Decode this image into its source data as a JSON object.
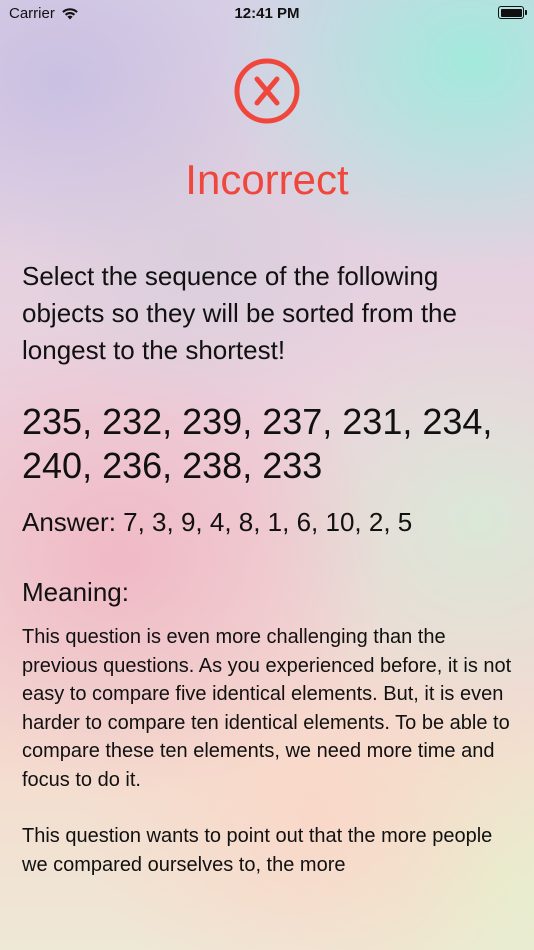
{
  "status_bar": {
    "carrier": "Carrier",
    "time": "12:41 PM",
    "battery_level": 1.0
  },
  "result": {
    "icon": "x-circle-icon",
    "title": "Incorrect",
    "color": "#f0473d"
  },
  "question": {
    "text": "Select the sequence of the following objects so they will be sorted from the longest to the shortest!",
    "sequence": "235, 232, 239, 237, 231, 234, 240, 236, 238, 233",
    "answer": "Answer: 7, 3, 9, 4, 8, 1, 6, 10, 2, 5"
  },
  "meaning": {
    "title": "Meaning:",
    "paragraphs": [
      "This question is even more challenging than the previous questions. As you experienced before, it is not easy to compare five identical elements. But, it is even harder to compare ten identical elements. To be able to compare these ten elements, we need more time and focus to do it.",
      "This question wants to point out that the more people we compared ourselves to, the more"
    ]
  }
}
